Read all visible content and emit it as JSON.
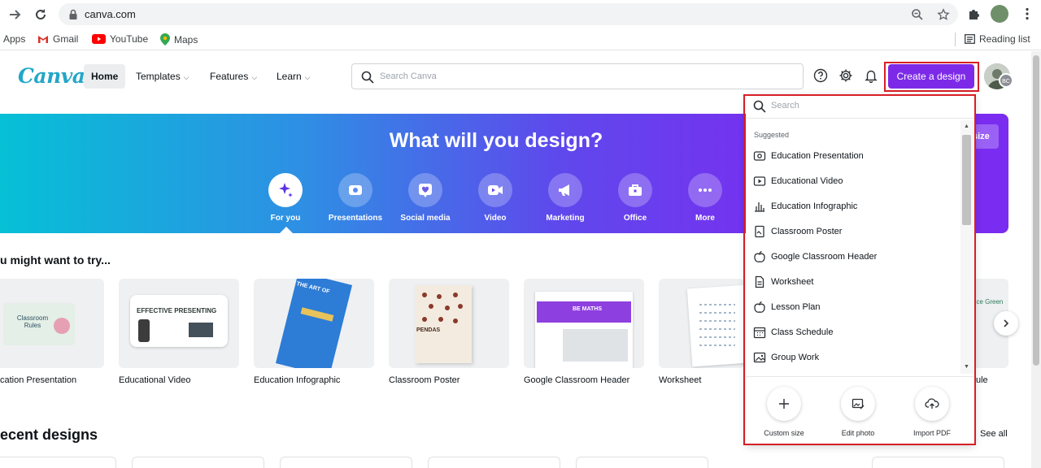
{
  "browser": {
    "url": "canva.com",
    "bookmarks": [
      {
        "label": "Apps",
        "icon": "apps-icon"
      },
      {
        "label": "Gmail",
        "icon": "gmail-icon"
      },
      {
        "label": "YouTube",
        "icon": "youtube-icon"
      },
      {
        "label": "Maps",
        "icon": "maps-icon"
      }
    ],
    "reading_list": "Reading list"
  },
  "header": {
    "logo": "Canva",
    "nav": [
      {
        "label": "Home"
      },
      {
        "label": "Templates"
      },
      {
        "label": "Features"
      },
      {
        "label": "Learn"
      }
    ],
    "search_placeholder": "Search Canva",
    "create_button": "Create a design",
    "avatar_initials": "BC",
    "accent_color": "#7d2ae8"
  },
  "hero": {
    "title": "What will you design?",
    "resize_label": "size",
    "categories": [
      {
        "label": "For you",
        "icon": "sparkle-icon"
      },
      {
        "label": "Presentations",
        "icon": "presentation-icon"
      },
      {
        "label": "Social media",
        "icon": "heart-icon"
      },
      {
        "label": "Video",
        "icon": "video-icon"
      },
      {
        "label": "Marketing",
        "icon": "megaphone-icon"
      },
      {
        "label": "Office",
        "icon": "briefcase-icon"
      },
      {
        "label": "More",
        "icon": "more-icon"
      }
    ]
  },
  "suggestions": {
    "title": "u might want to try...",
    "items": [
      {
        "label": "cation Presentation"
      },
      {
        "label": "Educational Video"
      },
      {
        "label": "Education Infographic"
      },
      {
        "label": "Classroom Poster"
      },
      {
        "label": "Google Classroom Header"
      },
      {
        "label": "Worksheet"
      },
      {
        "label": "ule"
      }
    ],
    "tile_texts": {
      "classroom_rules": "Classroom Rules",
      "effective_presenting": "EFFECTIVE PRESENTING",
      "the_art_of": "THE ART OF",
      "pendas": "PENDAS",
      "be_maths": "BE MATHS",
      "science_green": "nce Green"
    }
  },
  "recent": {
    "title": "ecent designs",
    "see_all": "See all"
  },
  "dropdown": {
    "search_placeholder": "Search",
    "suggested_label": "Suggested",
    "items": [
      {
        "label": "Education Presentation",
        "icon": "presentation-icon"
      },
      {
        "label": "Educational Video",
        "icon": "video-icon"
      },
      {
        "label": "Education Infographic",
        "icon": "bar-chart-icon"
      },
      {
        "label": "Classroom Poster",
        "icon": "poster-icon"
      },
      {
        "label": "Google Classroom Header",
        "icon": "apple-icon"
      },
      {
        "label": "Worksheet",
        "icon": "document-icon"
      },
      {
        "label": "Lesson Plan",
        "icon": "apple-icon"
      },
      {
        "label": "Class Schedule",
        "icon": "calendar-icon"
      },
      {
        "label": "Group Work",
        "icon": "image-icon"
      }
    ],
    "actions": [
      {
        "label": "Custom size",
        "icon": "plus-icon"
      },
      {
        "label": "Edit photo",
        "icon": "image-edit-icon"
      },
      {
        "label": "Import PDF",
        "icon": "upload-cloud-icon"
      }
    ]
  }
}
